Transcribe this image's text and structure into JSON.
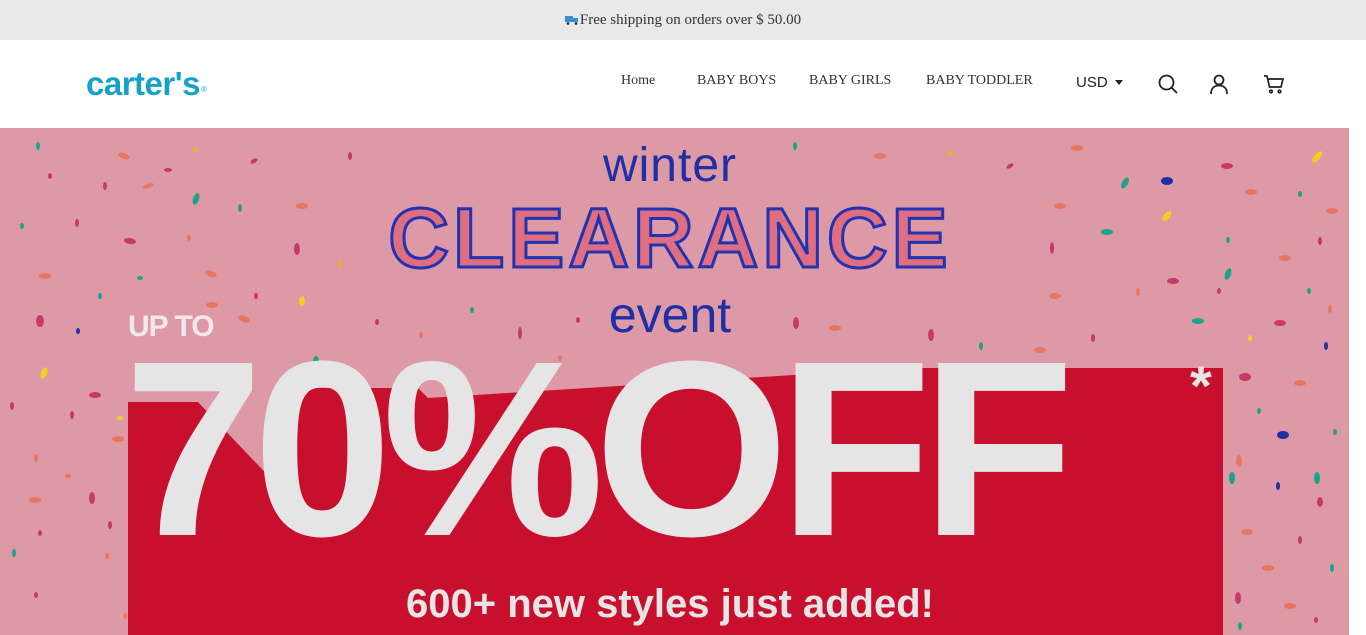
{
  "announcement": {
    "text": "Free shipping on orders over $ 50.00",
    "icon": "truck-icon"
  },
  "header": {
    "logo_text": "carter's",
    "logo_mark": "®",
    "brand_color": "#16a2c8",
    "nav": [
      {
        "label": "Home"
      },
      {
        "label": "BABY BOYS"
      },
      {
        "label": "BABY GIRLS"
      },
      {
        "label": "BABY TODDLER"
      }
    ],
    "currency": "USD",
    "icons": [
      "search-icon",
      "account-icon",
      "cart-icon"
    ]
  },
  "hero": {
    "line1": "winter",
    "line2": "CLEARANCE",
    "line3": "event",
    "up_to": "UP TO",
    "discount": "70%OFF",
    "asterisk": "*",
    "tagline": "600+ new styles just added!",
    "colors": {
      "background": "#de99a7",
      "accent_blue": "#1f2fa6",
      "accent_red": "#c8102e",
      "text_light": "#e5e5e5"
    }
  }
}
